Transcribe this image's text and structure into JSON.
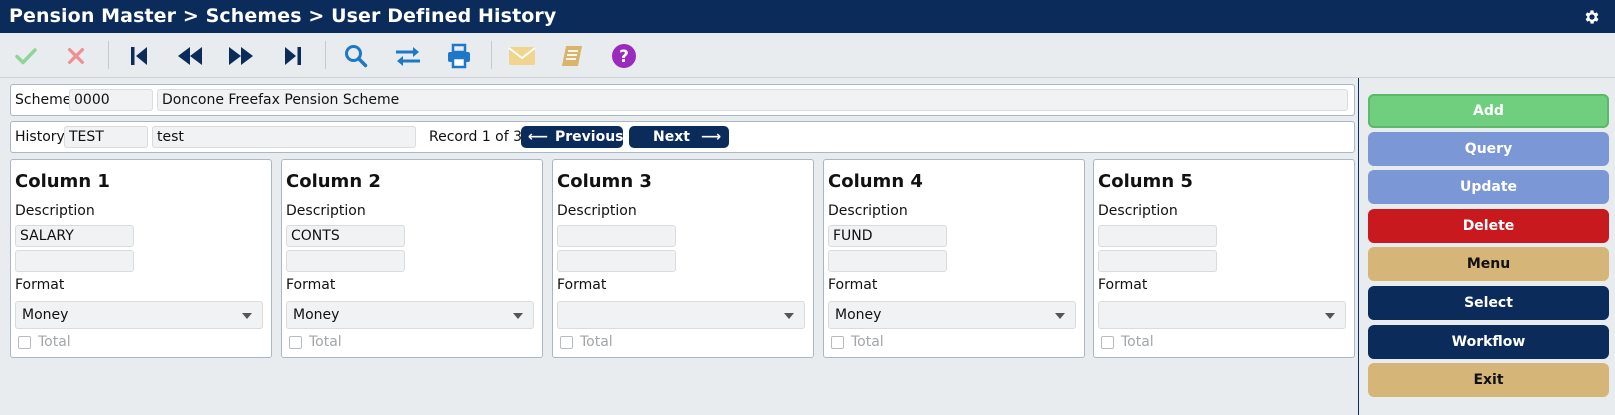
{
  "title": "Pension Master > Schemes > User Defined History",
  "icons": {
    "settings": "gear-icon",
    "toolbar": [
      "check-icon",
      "cancel-icon",
      "first-icon",
      "prev-icon",
      "next-icon",
      "last-icon",
      "search-icon",
      "swap-icon",
      "print-icon",
      "mail-icon",
      "notes-icon",
      "help-icon"
    ]
  },
  "colors": {
    "header": "#0b2b5b",
    "add": "#6fcf7e",
    "query": "#7b97d6",
    "update": "#7b97d6",
    "delete": "#c8191f",
    "menu": "#d6b678",
    "navy": "#0b2b5b"
  },
  "scheme": {
    "label": "Scheme",
    "code": "0000",
    "name": "Doncone Freefax Pension Scheme"
  },
  "history": {
    "label": "History",
    "code": "TEST",
    "description": "test",
    "record_text": "Record 1 of 3",
    "previous_label": "Previous",
    "next_label": "Next"
  },
  "columns": [
    {
      "title": "Column 1",
      "description_label": "Description",
      "description1": "SALARY",
      "description2": "",
      "format_label": "Format",
      "format": "Money",
      "total_label": "Total"
    },
    {
      "title": "Column 2",
      "description_label": "Description",
      "description1": "CONTS",
      "description2": "",
      "format_label": "Format",
      "format": "Money",
      "total_label": "Total"
    },
    {
      "title": "Column 3",
      "description_label": "Description",
      "description1": "",
      "description2": "",
      "format_label": "Format",
      "format": "",
      "total_label": "Total"
    },
    {
      "title": "Column 4",
      "description_label": "Description",
      "description1": "FUND",
      "description2": "",
      "format_label": "Format",
      "format": "Money",
      "total_label": "Total"
    },
    {
      "title": "Column 5",
      "description_label": "Description",
      "description1": "",
      "description2": "",
      "format_label": "Format",
      "format": "",
      "total_label": "Total"
    }
  ],
  "actions": {
    "add": "Add",
    "query": "Query",
    "update": "Update",
    "delete": "Delete",
    "menu": "Menu",
    "select": "Select",
    "workflow": "Workflow",
    "exit": "Exit"
  }
}
